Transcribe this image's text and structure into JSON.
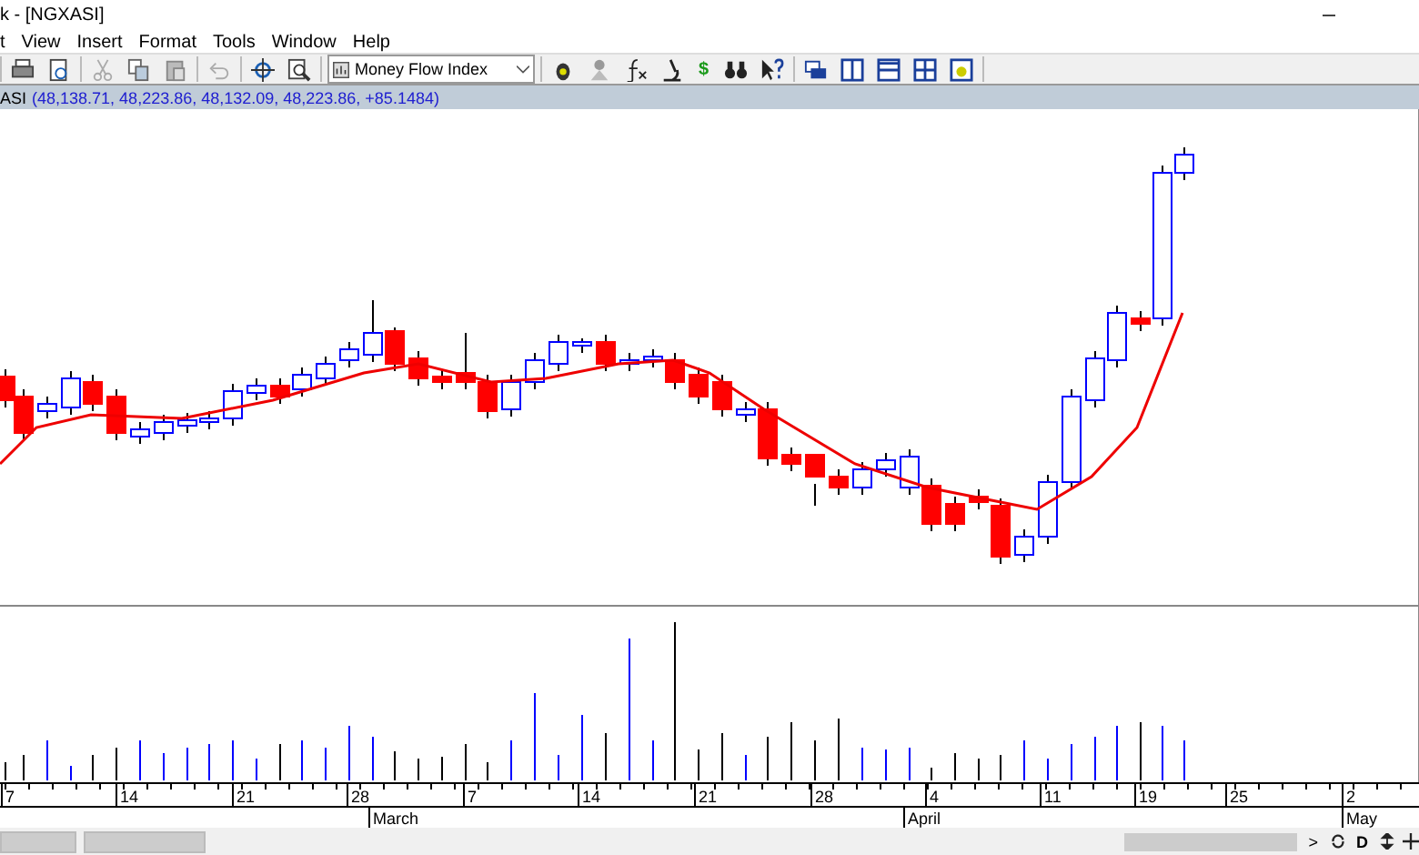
{
  "window": {
    "title": "k - [NGXASI]"
  },
  "menu": [
    "t",
    "View",
    "Insert",
    "Format",
    "Tools",
    "Window",
    "Help"
  ],
  "toolbar": {
    "indicator_dropdown": {
      "value": "Money Flow Index"
    },
    "currency_button": "$"
  },
  "info_bar": {
    "symbol": "ASI",
    "values": "(48,138.71, 48,223.86, 48,132.09, 48,223.86, +85.1484)"
  },
  "date_axis": {
    "days": [
      "7",
      "14",
      "21",
      "28",
      "7",
      "14",
      "21",
      "28",
      "4",
      "11",
      "19",
      "25",
      "2"
    ],
    "months": [
      "March",
      "April",
      "May"
    ]
  },
  "status_bar": {
    "next_label": ">",
    "period_label": "D"
  }
}
